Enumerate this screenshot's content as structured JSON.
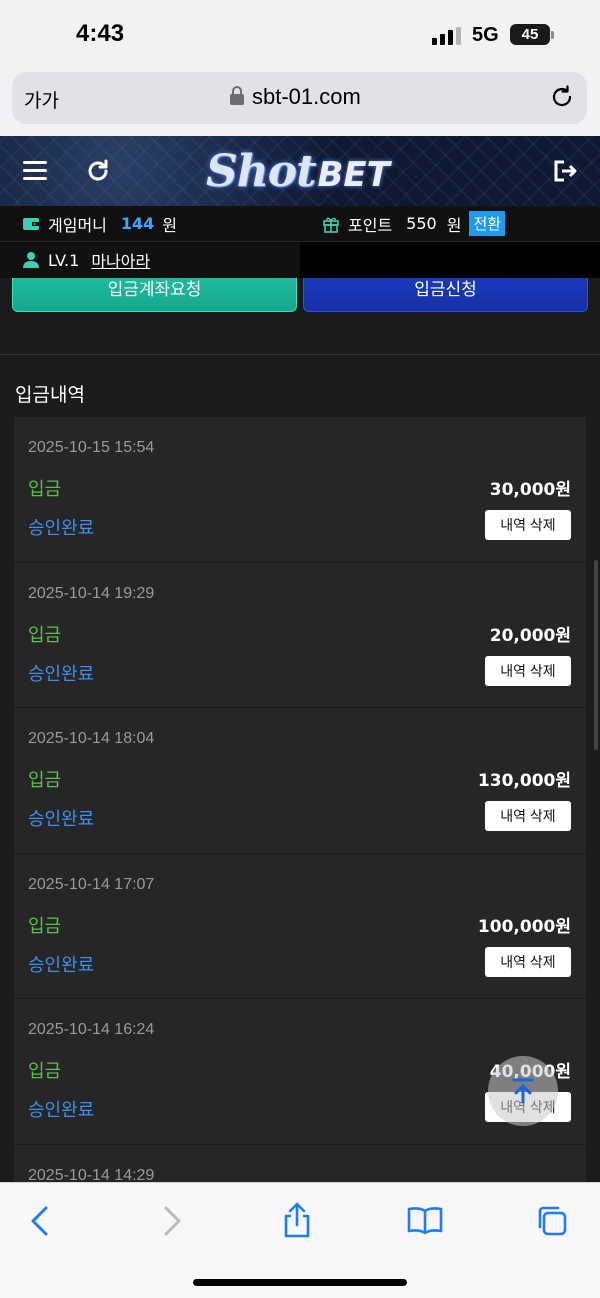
{
  "status_bar": {
    "time": "4:43",
    "network": "5G",
    "battery": "45"
  },
  "browser": {
    "text_size_label": "가가",
    "url": "sbt-01.com"
  },
  "site": {
    "logo_primary": "Shot",
    "logo_secondary": "BET"
  },
  "user_info": {
    "game_money_label": "게임머니",
    "game_money_value": "144",
    "game_money_unit": "원",
    "point_label": "포인트",
    "point_value": "550",
    "point_unit": "원",
    "convert_label": "전환",
    "level": "LV.1",
    "nickname": "마나아라"
  },
  "buttons": {
    "account_request": "입금계좌요청",
    "deposit_request": "입금신청"
  },
  "section_title": "입금내역",
  "history": [
    {
      "date": "2025-10-15 15:54",
      "type": "입금",
      "amount": "30,000원",
      "status": "승인완료",
      "delete_label": "내역 삭제"
    },
    {
      "date": "2025-10-14 19:29",
      "type": "입금",
      "amount": "20,000원",
      "status": "승인완료",
      "delete_label": "내역 삭제"
    },
    {
      "date": "2025-10-14 18:04",
      "type": "입금",
      "amount": "130,000원",
      "status": "승인완료",
      "delete_label": "내역 삭제"
    },
    {
      "date": "2025-10-14 17:07",
      "type": "입금",
      "amount": "100,000원",
      "status": "승인완료",
      "delete_label": "내역 삭제"
    },
    {
      "date": "2025-10-14 16:24",
      "type": "입금",
      "amount": "40,000원",
      "status": "승인완료",
      "delete_label": "내역 삭제"
    },
    {
      "date": "2025-10-14 14:29",
      "type": "",
      "amount": "",
      "status": "",
      "delete_label": ""
    }
  ],
  "colors": {
    "accent_blue": "#3ea6ff",
    "type_green": "#58c24a",
    "status_blue": "#3d8ff0",
    "convert_bg": "#1e9bf0"
  }
}
